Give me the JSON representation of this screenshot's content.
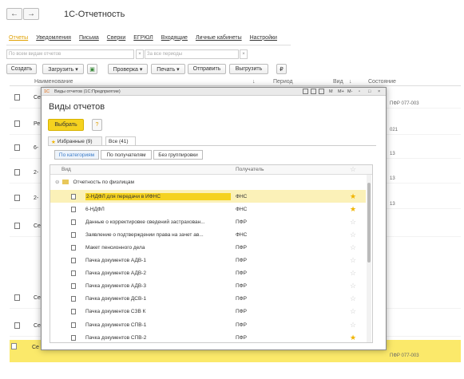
{
  "window": {
    "title": "1С-Отчетность"
  },
  "nav": {
    "back": "←",
    "forward": "→"
  },
  "tabs": [
    "Отчеты",
    "Уведомления",
    "Письма",
    "Сверки",
    "ЕГРЮЛ",
    "Входящие",
    "Личные кабинеты",
    "Настройки"
  ],
  "filters": {
    "kind_placeholder": "По всем видам отчетов",
    "period_placeholder": "За все периоды"
  },
  "toolbar": {
    "create": "Создать",
    "load": "Загрузить ▾",
    "check": "Проверка ▾",
    "print": "Печать ▾",
    "send": "Отправить",
    "unload": "Выгрузить",
    "ruble": "₽"
  },
  "columns": {
    "name": "Наименование",
    "period": "Период",
    "kind": "Вид",
    "state": "Состояние"
  },
  "bg_rows": [
    {
      "name": "Се",
      "state": "ПФР 077-003"
    },
    {
      "name": "Ре",
      "state": "021"
    },
    {
      "name": "6-",
      "state": "13"
    },
    {
      "name": "2-",
      "state": "13"
    },
    {
      "name": "2-",
      "state": "13"
    },
    {
      "name": "Се",
      "state": ""
    },
    {
      "name": "Се",
      "state": ""
    },
    {
      "name": "Се",
      "state": ""
    },
    {
      "name": "Се",
      "state": "ПФР 077-003"
    }
  ],
  "dialog": {
    "window_title": "Виды отчетов (1С:Предприятие)",
    "window_buttons": [
      "M",
      "M+",
      "M-"
    ],
    "heading": "Виды отчетов",
    "select_button": "Выбрать",
    "help": "?",
    "tab_favorites": "Избранные (9)",
    "tab_all": "Все (41)",
    "group_categories": "По категориям",
    "group_receivers": "По получателям",
    "group_none": "Без группировки",
    "col_kind": "Вид",
    "col_receiver": "Получатель",
    "group_label": "Отчетность по физлицам",
    "rows": [
      {
        "name": "2-НДФЛ для передачи в ИФНС",
        "receiver": "ФНС",
        "fav": true,
        "selected": true
      },
      {
        "name": "6-НДФЛ",
        "receiver": "ФНС",
        "fav": true,
        "selected": false
      },
      {
        "name": "Данные о корректировке сведений застрахован...",
        "receiver": "ПФР",
        "fav": false,
        "selected": false
      },
      {
        "name": "Заявление о подтверждении права на зачет ав...",
        "receiver": "ФНС",
        "fav": false,
        "selected": false
      },
      {
        "name": "Макет пенсионного дела",
        "receiver": "ПФР",
        "fav": false,
        "selected": false
      },
      {
        "name": "Пачка документов АДВ-1",
        "receiver": "ПФР",
        "fav": false,
        "selected": false
      },
      {
        "name": "Пачка документов АДВ-2",
        "receiver": "ПФР",
        "fav": false,
        "selected": false
      },
      {
        "name": "Пачка документов АДВ-3",
        "receiver": "ПФР",
        "fav": false,
        "selected": false
      },
      {
        "name": "Пачка документов ДСВ-1",
        "receiver": "ПФР",
        "fav": false,
        "selected": false
      },
      {
        "name": "Пачка документов СЗВ К",
        "receiver": "ПФР",
        "fav": false,
        "selected": false
      },
      {
        "name": "Пачка документов СПВ-1",
        "receiver": "ПФР",
        "fav": false,
        "selected": false
      },
      {
        "name": "Пачка документов СПВ-2",
        "receiver": "ПФР",
        "fav": true,
        "selected": false
      }
    ]
  },
  "colors": {
    "accent": "#f5d21f",
    "selected_row": "#fbe96a"
  }
}
